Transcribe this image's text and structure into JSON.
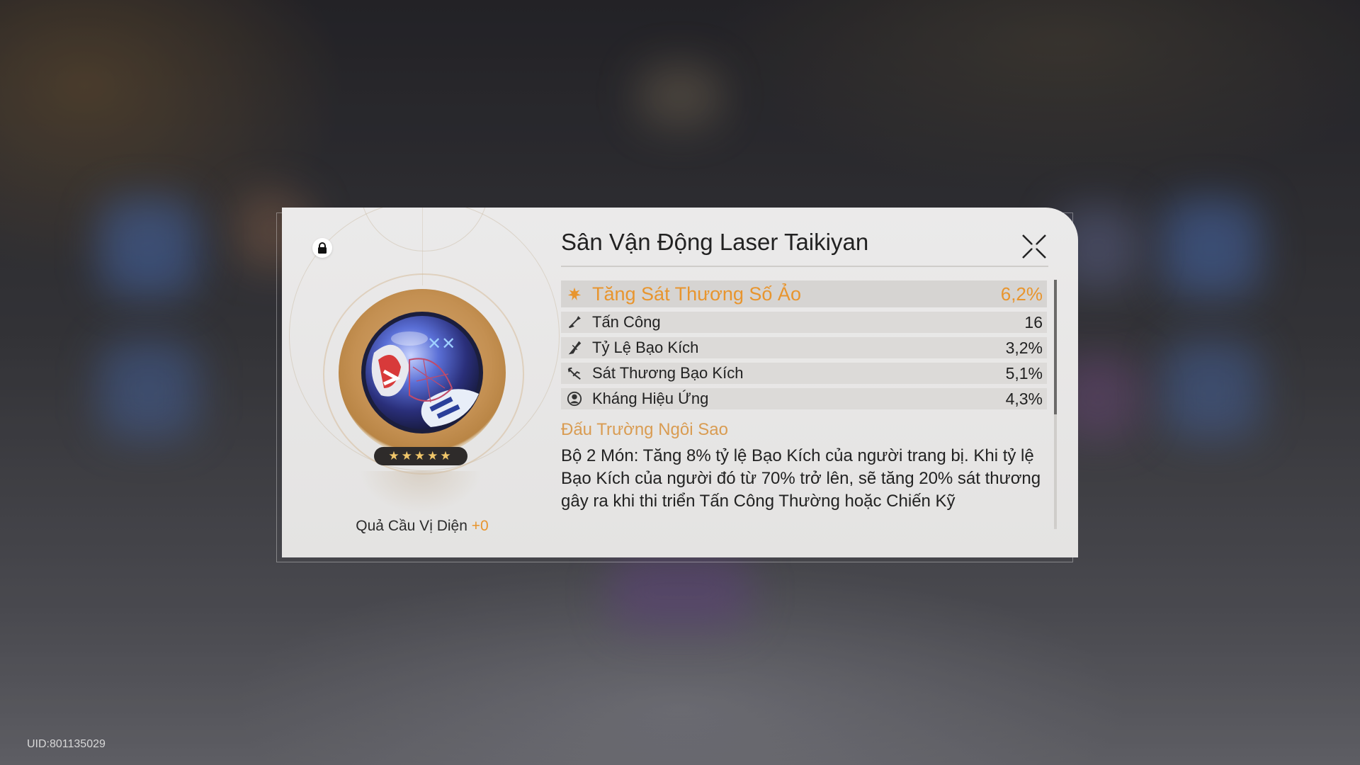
{
  "relic": {
    "title": "Sân Vận Động Laser Taikiyan",
    "name": "Quả Cầu Vị Diện",
    "level": "+0",
    "stars": "★★★★★",
    "locked": true
  },
  "main_stat": {
    "icon": "quantum-dmg-icon",
    "label": "Tăng Sát Thương Số Ảo",
    "value": "6,2%"
  },
  "sub_stats": [
    {
      "icon": "attack-icon",
      "label": "Tấn Công",
      "value": "16"
    },
    {
      "icon": "crit-rate-icon",
      "label": "Tỷ Lệ Bạo Kích",
      "value": "3,2%"
    },
    {
      "icon": "crit-dmg-icon",
      "label": "Sát Thương Bạo Kích",
      "value": "5,1%"
    },
    {
      "icon": "effect-res-icon",
      "label": "Kháng Hiệu Ứng",
      "value": "4,3%"
    }
  ],
  "set": {
    "name": "Đấu Trường Ngôi Sao",
    "description": "Bộ 2 Món: Tăng 8% tỷ lệ Bạo Kích của người trang bị. Khi tỷ lệ Bạo Kích của người đó từ 70% trở lên, sẽ tăng 20% sát thương gây ra khi thi triển Tấn Công Thường hoặc Chiến Kỹ"
  },
  "footer": {
    "uid": "UID:801135029"
  },
  "colors": {
    "accent": "#e8952e",
    "set_name": "#d99c52",
    "panel": "#e6e5e4"
  }
}
